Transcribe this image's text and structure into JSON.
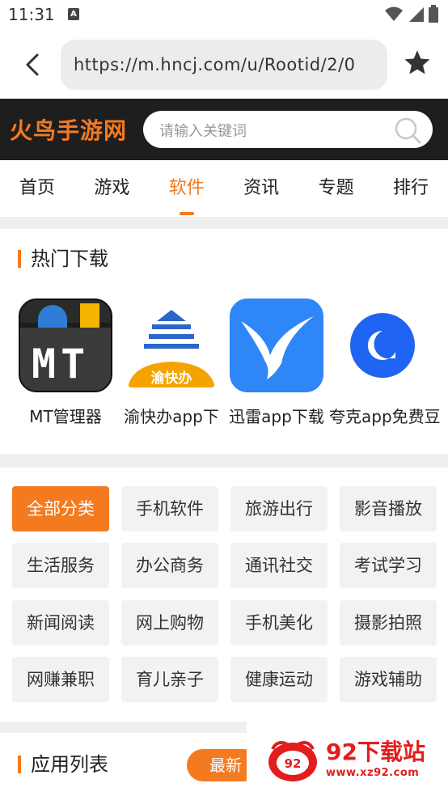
{
  "status": {
    "time": "11:31",
    "notification_icon": "A"
  },
  "browser": {
    "url": "https://m.hncj.com/u/Rootid/2/0"
  },
  "site": {
    "logo": "火鸟手游网",
    "search_placeholder": "请输入关键词"
  },
  "nav": [
    "首页",
    "游戏",
    "软件",
    "资讯",
    "专题",
    "排行"
  ],
  "nav_active": "软件",
  "hot": {
    "title": "热门下载",
    "apps": [
      "MT管理器",
      "渝快办app下",
      "迅雷app下载",
      "夸克app免费豆"
    ]
  },
  "categories": [
    "全部分类",
    "手机软件",
    "旅游出行",
    "影音播放",
    "生活服务",
    "办公商务",
    "通讯社交",
    "考试学习",
    "新闻阅读",
    "网上购物",
    "手机美化",
    "摄影拍照",
    "网赚兼职",
    "育儿亲子",
    "健康运动",
    "游戏辅助"
  ],
  "app_list": {
    "title": "应用列表",
    "latest": "最新"
  },
  "watermark": {
    "title": "92下载站",
    "url": "www.xz92.com",
    "logo_text": "92"
  },
  "colors": {
    "accent": "#f47a1f",
    "header_bg": "#1e1e1e",
    "watermark": "#e21d1d"
  }
}
